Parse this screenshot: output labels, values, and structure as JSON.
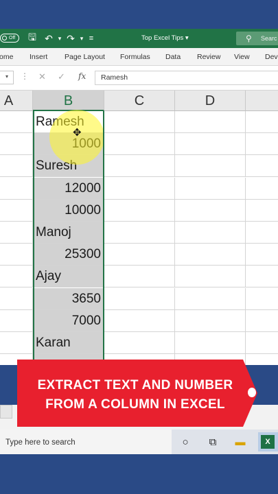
{
  "titlebar": {
    "autosave_state": "Off",
    "title": "Top Excel Tips",
    "title_caret": "▾",
    "search_label": "Searc"
  },
  "ribbon": {
    "tabs": [
      "ome",
      "Insert",
      "Page Layout",
      "Formulas",
      "Data",
      "Review",
      "View",
      "Deve"
    ]
  },
  "formula_bar": {
    "value": "Ramesh",
    "fx": "fx"
  },
  "columns": [
    "A",
    "B",
    "C",
    "D"
  ],
  "cells_b": [
    "Ramesh",
    "1000",
    "Suresh",
    "12000",
    "10000",
    "Manoj",
    "25300",
    "Ajay",
    "3650",
    "7000",
    "Karan"
  ],
  "banner": {
    "line1": "EXTRACT TEXT AND NUMBER",
    "line2": "FROM A COLUMN IN EXCEL"
  },
  "taskbar": {
    "search_placeholder": "Type here to search"
  },
  "colors": {
    "excel_green": "#217346",
    "banner_red": "#e8202e",
    "selection_gray": "#d2d2d2",
    "highlight_yellow": "#fff528",
    "frame_blue": "#2a4a86"
  }
}
